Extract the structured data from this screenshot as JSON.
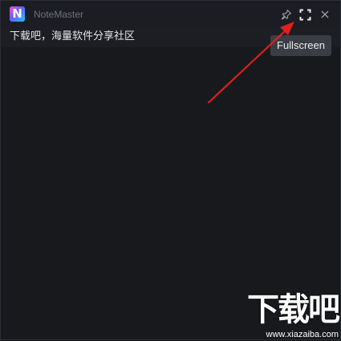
{
  "window": {
    "title": "NoteMaster",
    "logo_letter": "N"
  },
  "titlebar": {
    "pin_icon": "pin-icon",
    "fullscreen_icon": "fullscreen-icon",
    "close_icon": "close-icon"
  },
  "note": {
    "text": "下载吧，海量软件分享社区"
  },
  "tooltip": {
    "label": "Fullscreen"
  },
  "annotation": {
    "arrow_color": "#e01f1f"
  },
  "watermark": {
    "title": "下载吧",
    "url": "www.xiazaiba.com"
  }
}
